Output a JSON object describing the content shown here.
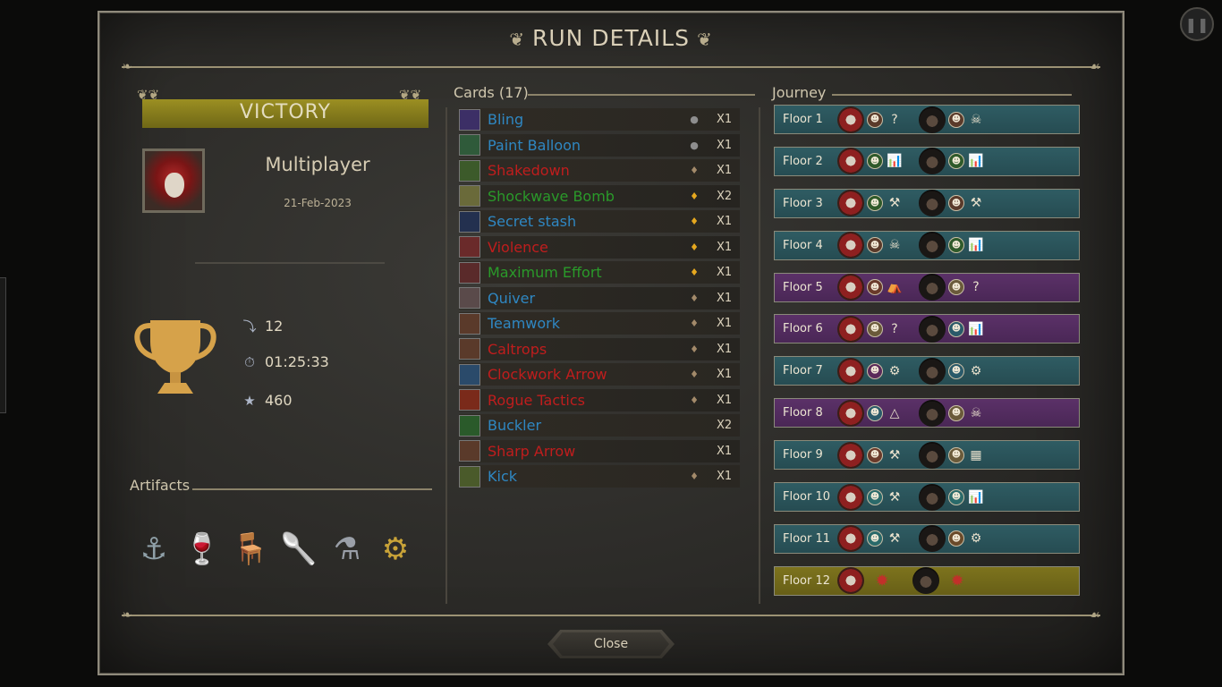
{
  "title": "RUN DETAILS",
  "result": "VICTORY",
  "mode": "Multiplayer",
  "date": "21-Feb-2023",
  "stats": {
    "floors": "12",
    "time": "01:25:33",
    "score": "460"
  },
  "artifacts_label": "Artifacts",
  "artifacts": [
    {
      "name": "anchor-icon",
      "glyph": "⚓",
      "color": "#8fa0a8"
    },
    {
      "name": "goblet-icon",
      "glyph": "🍷",
      "color": "#c9a130"
    },
    {
      "name": "chair-icon",
      "glyph": "🪑",
      "color": "#b3834c"
    },
    {
      "name": "spoon-icon",
      "glyph": "🥄",
      "color": "#b7b7b7"
    },
    {
      "name": "pipe-icon",
      "glyph": "⚗",
      "color": "#9a9fa8"
    },
    {
      "name": "gear-icon",
      "glyph": "⚙",
      "color": "#c9a338"
    }
  ],
  "cards_label": "Cards (17)",
  "cards": [
    {
      "name": "Bling",
      "color": "#2f87c2",
      "rarity": "●",
      "rarity_color": "#8e8e8e",
      "qty": "X1",
      "thumb": "#3c2f66"
    },
    {
      "name": "Paint Balloon",
      "color": "#2f87c2",
      "rarity": "●",
      "rarity_color": "#8e8e8e",
      "qty": "X1",
      "thumb": "#2f5a3a"
    },
    {
      "name": "Shakedown",
      "color": "#c01d1d",
      "rarity": "♦",
      "rarity_color": "#a38a6a",
      "qty": "X1",
      "thumb": "#3c5a2a"
    },
    {
      "name": "Shockwave Bomb",
      "color": "#2a9a2a",
      "rarity": "♦",
      "rarity_color": "#e6a81f",
      "qty": "X2",
      "thumb": "#6a6a3a"
    },
    {
      "name": "Secret stash",
      "color": "#2f87c2",
      "rarity": "♦",
      "rarity_color": "#e6a81f",
      "qty": "X1",
      "thumb": "#23304f"
    },
    {
      "name": "Violence",
      "color": "#c01d1d",
      "rarity": "♦",
      "rarity_color": "#e6a81f",
      "qty": "X1",
      "thumb": "#6a2a2a"
    },
    {
      "name": "Maximum Effort",
      "color": "#2a9a2a",
      "rarity": "♦",
      "rarity_color": "#e6a81f",
      "qty": "X1",
      "thumb": "#5a2a2a"
    },
    {
      "name": "Quiver",
      "color": "#2f87c2",
      "rarity": "♦",
      "rarity_color": "#a38a6a",
      "qty": "X1",
      "thumb": "#5a4a4a"
    },
    {
      "name": "Teamwork",
      "color": "#2f87c2",
      "rarity": "♦",
      "rarity_color": "#a38a6a",
      "qty": "X1",
      "thumb": "#5a3a2a"
    },
    {
      "name": "Caltrops",
      "color": "#c01d1d",
      "rarity": "♦",
      "rarity_color": "#a38a6a",
      "qty": "X1",
      "thumb": "#5a3a2a"
    },
    {
      "name": "Clockwork Arrow",
      "color": "#c01d1d",
      "rarity": "♦",
      "rarity_color": "#a38a6a",
      "qty": "X1",
      "thumb": "#2a4a6a"
    },
    {
      "name": "Rogue Tactics",
      "color": "#c01d1d",
      "rarity": "♦",
      "rarity_color": "#a38a6a",
      "qty": "X1",
      "thumb": "#7a2a1a"
    },
    {
      "name": "Buckler",
      "color": "#2f87c2",
      "rarity": "",
      "rarity_color": "#a38a6a",
      "qty": "X2",
      "thumb": "#2a5a2a"
    },
    {
      "name": "Sharp Arrow",
      "color": "#c01d1d",
      "rarity": "",
      "rarity_color": "#a38a6a",
      "qty": "X1",
      "thumb": "#5a3a2a"
    },
    {
      "name": "Kick",
      "color": "#2f87c2",
      "rarity": "♦",
      "rarity_color": "#a38a6a",
      "qty": "X1",
      "thumb": "#4a5a2a"
    }
  ],
  "journey_label": "Journey",
  "floors": [
    {
      "label": "Floor 1",
      "theme": "teal",
      "p1": [
        "#5a3a2a",
        "?"
      ],
      "p2": [
        "#5a3a2a",
        "☠"
      ]
    },
    {
      "label": "Floor 2",
      "theme": "teal",
      "p1": [
        "#2f5a2a",
        "📊"
      ],
      "p2": [
        "#2f5a2a",
        "📊"
      ]
    },
    {
      "label": "Floor 3",
      "theme": "teal",
      "p1": [
        "#2f5a2a",
        "⚒"
      ],
      "p2": [
        "#5a3a2a",
        "⚒"
      ]
    },
    {
      "label": "Floor 4",
      "theme": "teal",
      "p1": [
        "#5a3a2a",
        "☠"
      ],
      "p2": [
        "#2f5a2a",
        "📊"
      ]
    },
    {
      "label": "Floor 5",
      "theme": "purple",
      "p1": [
        "#6a3a2a",
        "⛺"
      ],
      "p2": [
        "#6a5a3a",
        "?"
      ]
    },
    {
      "label": "Floor 6",
      "theme": "purple",
      "p1": [
        "#6a5a3a",
        "?"
      ],
      "p2": [
        "#2a5a6a",
        "📊"
      ]
    },
    {
      "label": "Floor 7",
      "theme": "teal",
      "p1": [
        "#5a2a5a",
        "⚙"
      ],
      "p2": [
        "#2a5a6a",
        "⚙"
      ]
    },
    {
      "label": "Floor 8",
      "theme": "purple",
      "p1": [
        "#2a5a6a",
        "△"
      ],
      "p2": [
        "#6a5a3a",
        "☠"
      ]
    },
    {
      "label": "Floor 9",
      "theme": "teal",
      "p1": [
        "#6a3a2a",
        "⚒"
      ],
      "p2": [
        "#6a5a3a",
        "▦"
      ]
    },
    {
      "label": "Floor 10",
      "theme": "teal",
      "p1": [
        "#2a6a6a",
        "⚒"
      ],
      "p2": [
        "#2a6a6a",
        "📊"
      ]
    },
    {
      "label": "Floor 11",
      "theme": "teal",
      "p1": [
        "#2a6a6a",
        "⚒"
      ],
      "p2": [
        "#6a4a2a",
        "⚙"
      ]
    },
    {
      "label": "Floor 12",
      "theme": "olive",
      "boss": true
    }
  ],
  "close_label": "Close"
}
